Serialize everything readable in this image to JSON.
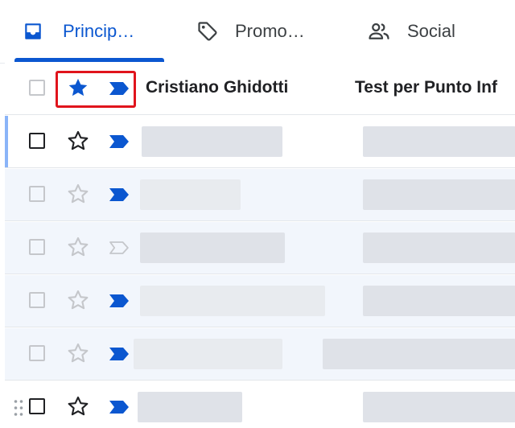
{
  "tabs": [
    {
      "label": "Princip…",
      "icon": "inbox-icon",
      "selected": true
    },
    {
      "label": "Promo…",
      "icon": "tag-icon",
      "selected": false
    },
    {
      "label": "Social",
      "icon": "people-icon",
      "selected": false
    }
  ],
  "emails": [
    {
      "sender": "Cristiano Ghidotti",
      "subject": "Test per Punto Inf",
      "starred": true,
      "important": true,
      "unread": true
    }
  ],
  "colors": {
    "accent": "#0b57d0",
    "highlight": "#e0141c"
  }
}
